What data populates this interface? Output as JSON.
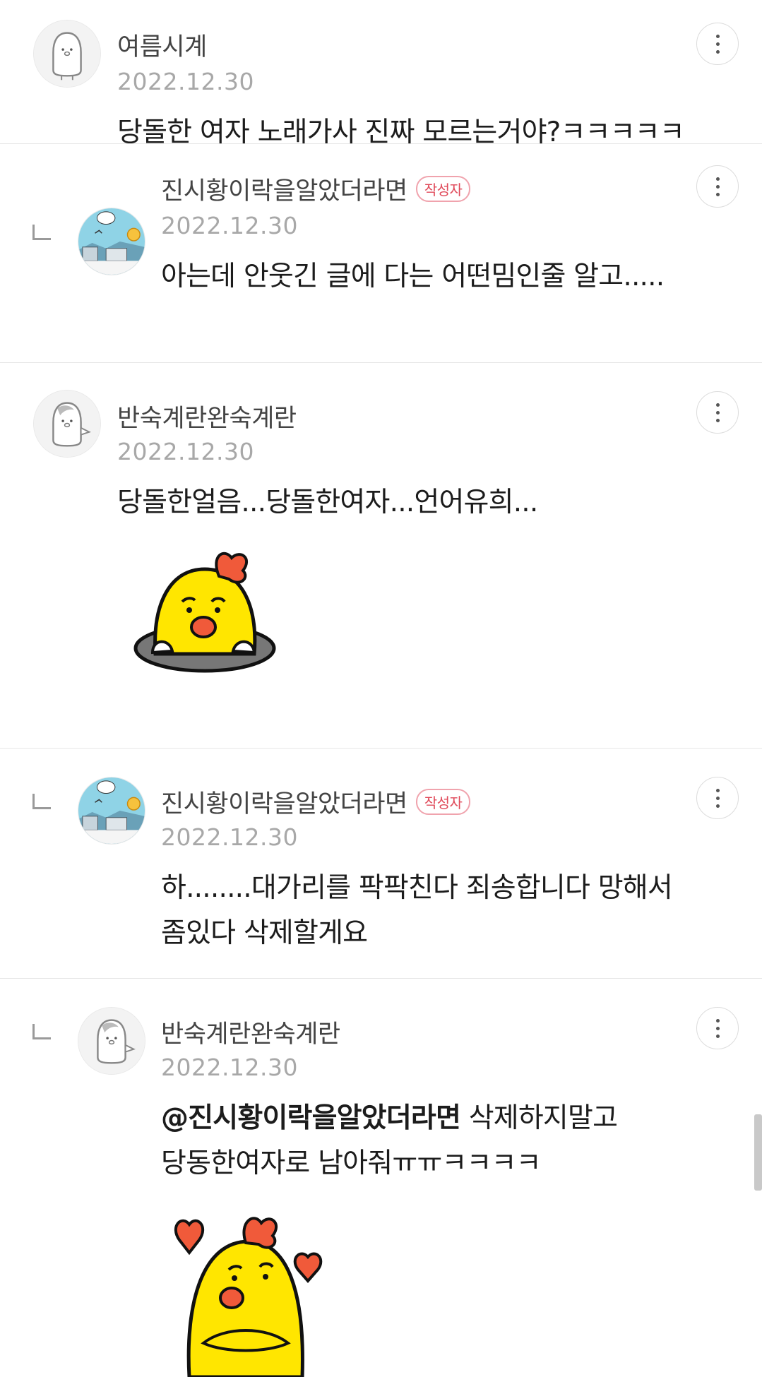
{
  "comments": [
    {
      "nickname": "여름시계",
      "date": "2022.12.30",
      "text": "당돌한 여자 노래가사 진짜 모르는거야?ㅋㅋㅋㅋㅋ"
    },
    {
      "nickname": "진시황이락을알았더라면",
      "author_badge": "작성자",
      "date": "2022.12.30",
      "text": "아는데 안웃긴 글에 다는 어떤밈인줄 알고....."
    },
    {
      "nickname": "반숙계란완숙계란",
      "date": "2022.12.30",
      "text": "당돌한얼음...당돌한여자...언어유희..."
    },
    {
      "nickname": "진시황이락을알았더라면",
      "author_badge": "작성자",
      "date": "2022.12.30",
      "text_line1": "하........대가리를 팍팍친다 죄송합니다 망해서",
      "text_line2": "좀있다 삭제할게요"
    },
    {
      "nickname": "반숙계란완숙계란",
      "date": "2022.12.30",
      "mention": "@진시황이락을알았더라면",
      "text_line1_rest": " 삭제하지말고",
      "text_line2": "당동한여자로 남아줘ㅠㅠㅋㅋㅋㅋ"
    }
  ],
  "icons": {
    "more": "more-vertical-icon",
    "reply": "reply-indent-icon"
  },
  "colors": {
    "badge_text": "#e04a5a",
    "badge_border": "#f0a3ad",
    "date": "#a8a8a8",
    "divider": "#e6e6e6",
    "sticker_yellow": "#ffe600",
    "sticker_bow": "#f05a3a"
  }
}
